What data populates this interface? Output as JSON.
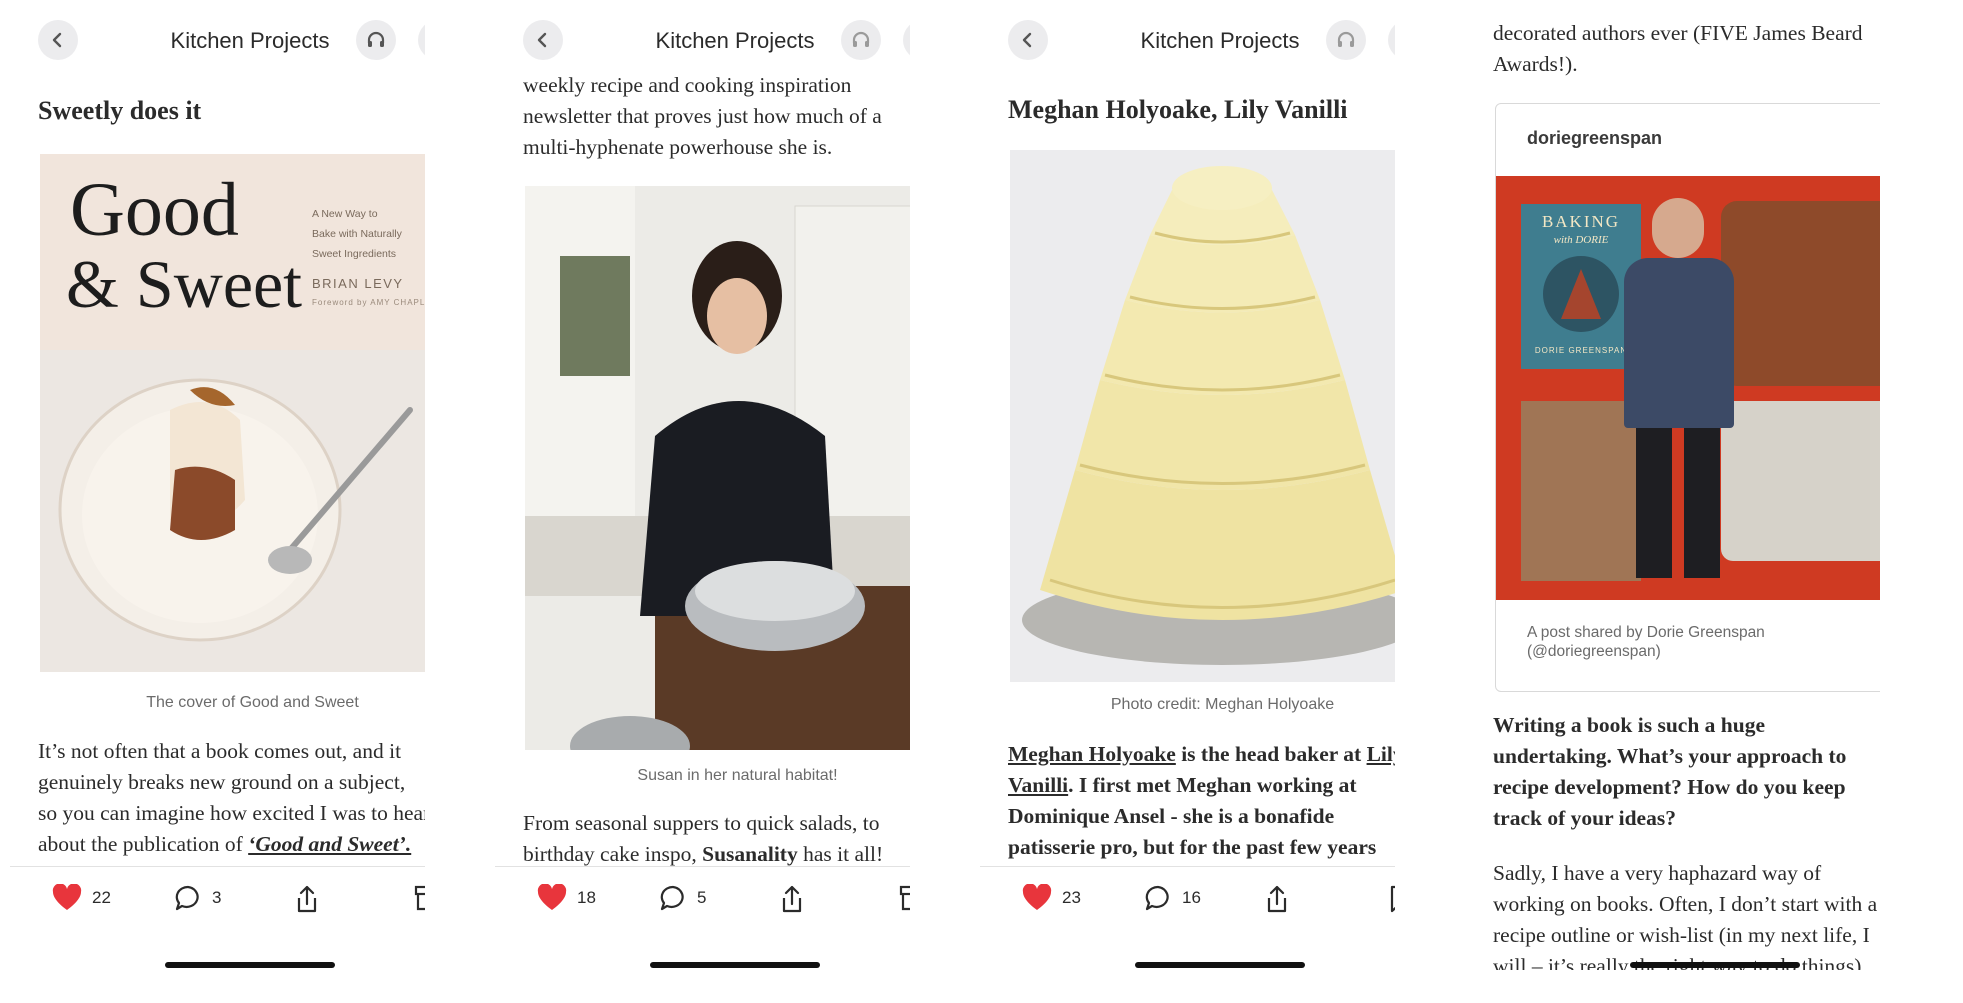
{
  "panels": [
    {
      "title": "Kitchen Projects",
      "heading": "Sweetly does it",
      "caption": "The cover of Good and Sweet",
      "book": {
        "title_line1": "Good",
        "title_line2": "& Sweet",
        "subtitle_line1": "A New Way to",
        "subtitle_line2": "Bake with Naturally",
        "subtitle_line3": "Sweet Ingredients",
        "author": "BRIAN LEVY",
        "foreword": "Foreword by AMY CHAPLIN"
      },
      "body": {
        "l1": "It’s not often that a book comes out, and it",
        "l2": "genuinely breaks new ground on a subject,",
        "l3": "so you can imagine how excited I was to hear",
        "l4": "about the publication of ",
        "l4_link": "‘Good and Sweet’."
      },
      "likes": "22",
      "comments": "3"
    },
    {
      "title": "Kitchen Projects",
      "intro": {
        "l1": "weekly recipe and cooking inspiration",
        "l2": "newsletter that proves just how much of a",
        "l3": "multi-hyphenate powerhouse she is."
      },
      "caption": "Susan in her natural habitat!",
      "body": {
        "l1": "From seasonal suppers to quick salads, to",
        "l2_a": "birthday cake inspo, ",
        "l2_b": "Susanality",
        "l2_c": " has it all!"
      },
      "likes": "18",
      "comments": "5"
    },
    {
      "title": "Kitchen Projects",
      "heading": "Meghan Holyoake, Lily Vanilli",
      "caption": "Photo credit: Meghan Holyoake",
      "body": {
        "l1_link1": "Meghan Holyoake",
        "l1_mid": " is the head baker at ",
        "l1_link2": "Lily",
        "l2_link": "Vanilli",
        "l2_rest": ". I first met Meghan working at",
        "l3": "Dominique Ansel - she is a bonafide",
        "l4": "patisserie pro, but for the past few years"
      },
      "likes": "23",
      "comments": "16"
    },
    {
      "intro": {
        "l1": "decorated authors ever (FIVE James Beard",
        "l2": "Awards!)."
      },
      "embed": {
        "username": "doriegreenspan",
        "book_line1": "BAKING",
        "book_line2": "with DORIE",
        "book_author": "DORIE GREENSPAN",
        "footer_line1": "A post shared by Dorie Greenspan",
        "footer_line2": "(@doriegreenspan)"
      },
      "question": {
        "l1": "Writing a book is such a huge",
        "l2": "undertaking. What’s your approach to",
        "l3": "recipe development? How do you keep",
        "l4": "track of your ideas?"
      },
      "answer": {
        "l1": "Sadly, I have a very haphazard way of",
        "l2": "working on books. Often, I don’t start with a",
        "l3": "recipe outline or wish-list (in my next life, I",
        "l4": "will – it’s really the right way to do things)"
      }
    }
  ],
  "colors": {
    "heart": "#e8353c",
    "text": "#2b2b2b",
    "caption": "#6b6b6b",
    "button_bg": "#ececee",
    "embed_bg": "#cf3a22"
  }
}
